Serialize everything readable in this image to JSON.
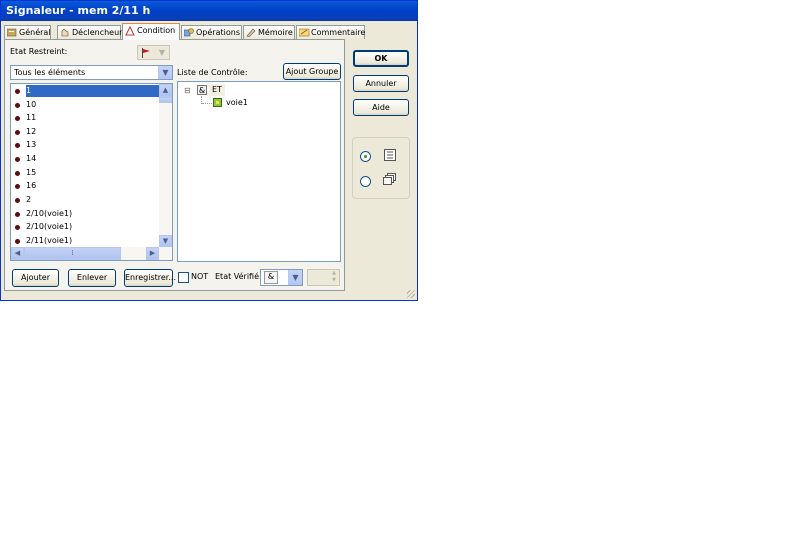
{
  "window": {
    "title": "Signaleur - mem 2/11  h"
  },
  "tabs": [
    {
      "label": "Général"
    },
    {
      "label": "Déclencheur"
    },
    {
      "label": "Condition"
    },
    {
      "label": "Opérations"
    },
    {
      "label": "Mémoire"
    },
    {
      "label": "Commentaire"
    }
  ],
  "left": {
    "etat_restreint_label": "Etat Restreint:",
    "filter_value": "Tous les éléments",
    "items": [
      "1",
      "10",
      "11",
      "12",
      "13",
      "14",
      "15",
      "16",
      "2",
      "2/10(voie1)",
      "2/10(voie1)",
      "2/11(voie1)"
    ],
    "selected_index": 0
  },
  "right": {
    "liste_label": "Liste de Contrôle:",
    "ajout_groupe": "Ajout Groupe",
    "tree": {
      "root_icon": "&",
      "root_label": "ET",
      "child_label": "voie1",
      "expander": "⊟"
    }
  },
  "bottom": {
    "ajouter": "Ajouter",
    "enlever": "Enlever",
    "enregistrer": "Enregistrer...",
    "not_label": "NOT",
    "etat_verifie_label": "Etat Vérifié:",
    "etat_verifie_value": "&"
  },
  "side": {
    "ok": "OK",
    "annuler": "Annuler",
    "aide": "Aide"
  },
  "icons": {
    "flag": "flag-icon",
    "list_view": "list-view-icon",
    "windows_view": "windows-view-icon"
  },
  "colors": {
    "title_bar": "#0041c8",
    "selection": "#316ac5",
    "tab_highlight": "#e68b2c"
  }
}
